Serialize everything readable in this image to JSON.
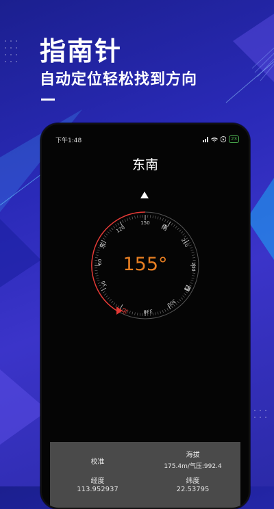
{
  "promo": {
    "title": "指南针",
    "subtitle": "自动定位轻松找到方向"
  },
  "status_bar": {
    "time": "下午1:48",
    "battery": "23"
  },
  "compass": {
    "direction_label": "东南",
    "heading": "155°",
    "heading_value": 155,
    "ring_numbers": [
      "150",
      "120",
      "60",
      "30",
      "330",
      "300",
      "240",
      "210"
    ],
    "cardinal_labels": {
      "south": "南",
      "east": "东",
      "north": "北",
      "west": "西"
    },
    "accent_color": "#e67e22",
    "pointer_color": "#e53935"
  },
  "info_panel": {
    "calibrate_label": "校准",
    "altitude_label": "海拔",
    "altitude_value": "175.4m/气压:992.4",
    "longitude_label": "经度",
    "longitude_value": "113.952937",
    "latitude_label": "纬度",
    "latitude_value": "22.53795"
  }
}
